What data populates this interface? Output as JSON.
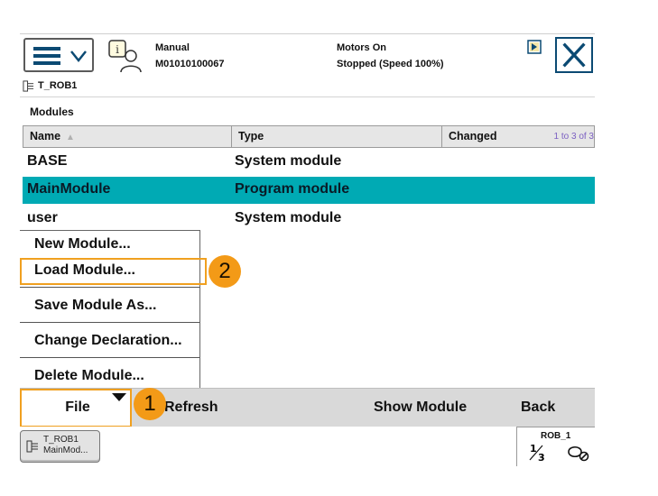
{
  "header": {
    "menu_label": "ABB menu",
    "status": {
      "mode": "Manual",
      "controller_id": "M01010100067",
      "motors": "Motors On",
      "run_state": "Stopped (Speed 100%)"
    },
    "task_label": "T_ROB1"
  },
  "modules": {
    "title": "Modules",
    "columns": {
      "name": "Name",
      "type": "Type",
      "changed": "Changed"
    },
    "range_text": "1 to 3 of 3",
    "rows": [
      {
        "name": "BASE",
        "type": "System module",
        "changed": ""
      },
      {
        "name": "MainModule",
        "type": "Program module",
        "changed": ""
      },
      {
        "name": "user",
        "type": "System module",
        "changed": ""
      }
    ],
    "selected_index": 1
  },
  "file_menu": {
    "items": [
      "New Module...",
      "Load Module...",
      "Save Module As...",
      "Change Declaration...",
      "Delete Module..."
    ]
  },
  "annotations": {
    "badge_1": "1",
    "badge_2": "2",
    "highlight_color": "#f0a020"
  },
  "commands": {
    "file": "File",
    "refresh": "Refresh",
    "show_module": "Show Module",
    "back": "Back"
  },
  "taskbar": {
    "task_line1": "T_ROB1",
    "task_line2": "MainMod...",
    "quickset_title": "ROB_1",
    "quickset_fraction": "1/3"
  },
  "colors": {
    "selected_row": "#00aab4",
    "accent_blue": "#0b4a73",
    "highlight": "#f0a020"
  }
}
